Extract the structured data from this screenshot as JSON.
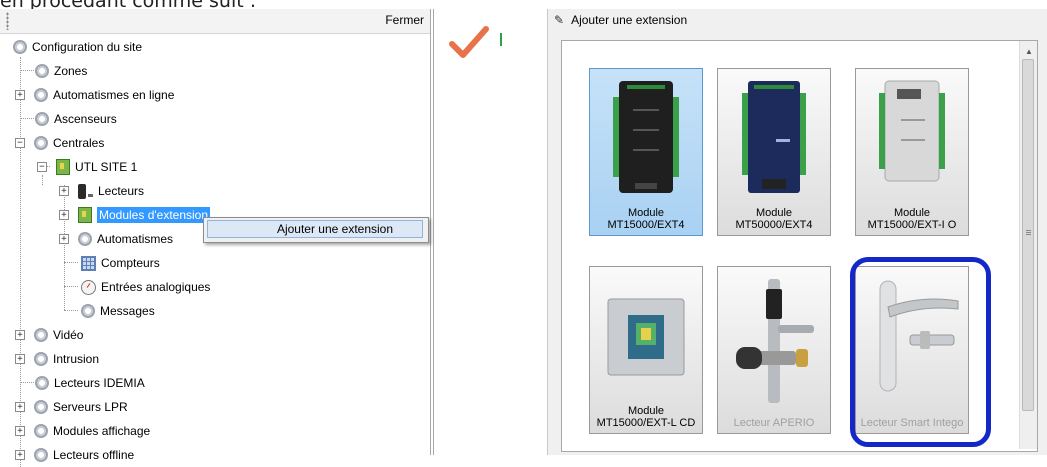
{
  "top_text": "en procédant comme suit :",
  "tree_panel": {
    "close_label": "Fermer",
    "nodes": [
      {
        "label": "Configuration du site"
      },
      {
        "label": "Zones"
      },
      {
        "label": "Automatismes en ligne"
      },
      {
        "label": "Ascenseurs"
      },
      {
        "label": "Centrales"
      },
      {
        "label": "UTL SITE 1"
      },
      {
        "label": "Lecteurs"
      },
      {
        "label": "Modules d'extension"
      },
      {
        "label": "Automatismes"
      },
      {
        "label": "Compteurs"
      },
      {
        "label": "Entrées analogiques"
      },
      {
        "label": "Messages"
      },
      {
        "label": "Vidéo"
      },
      {
        "label": "Intrusion"
      },
      {
        "label": "Lecteurs IDEMIA"
      },
      {
        "label": "Serveurs LPR"
      },
      {
        "label": "Modules affichage"
      },
      {
        "label": "Lecteurs offline"
      }
    ],
    "expanders": {
      "plus": "+",
      "minus": "−"
    }
  },
  "context_menu": {
    "item_label": "Ajouter une extension"
  },
  "dialog": {
    "title": "Ajouter une extension",
    "tiles": [
      {
        "label": "Module MT15000/EXT4"
      },
      {
        "label": "Module MT50000/EXT4"
      },
      {
        "label": "Module MT15000/EXT-I O"
      },
      {
        "label": "Module MT15000/EXT-L CD"
      },
      {
        "label": "Lecteur APERIO"
      },
      {
        "label": "Lecteur Smart Intego"
      }
    ]
  },
  "colors": {
    "selection": "#3399ff",
    "highlight_ring": "#1428c8",
    "checkmark": "#e8734a"
  }
}
